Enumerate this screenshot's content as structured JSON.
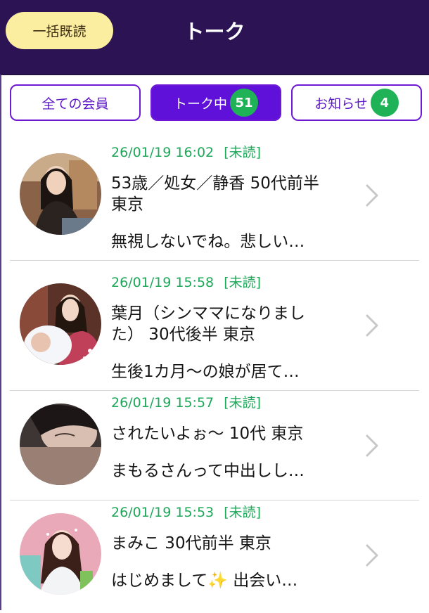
{
  "header": {
    "read_all_label": "一括既読",
    "title": "トーク"
  },
  "tabs": [
    {
      "label": "全ての会員",
      "badge": null
    },
    {
      "label": "トーク中",
      "badge": "51"
    },
    {
      "label": "お知らせ",
      "badge": "4"
    }
  ],
  "conversations": [
    {
      "timestamp": "26/01/19 16:02",
      "status": "[未読]",
      "name": "53歳／処女／静香 50代前半 東京",
      "preview": "無視しないでね。悲しい…"
    },
    {
      "timestamp": "26/01/19 15:58",
      "status": "[未読]",
      "name": "葉月（シンママになりました） 30代後半 東京",
      "preview": "生後1カ月～の娘が居て…"
    },
    {
      "timestamp": "26/01/19 15:57",
      "status": "[未読]",
      "name": "されたいよぉ～ 10代 東京",
      "preview": "まもるさんって中出しし…"
    },
    {
      "timestamp": "26/01/19 15:53",
      "status": "[未読]",
      "name": "まみこ 30代前半 東京",
      "preview_before": "はじめまして",
      "preview_emoji": "✨",
      "preview_after": " 出会い…"
    }
  ],
  "colors": {
    "header_bg": "#2c1454",
    "accent": "#5f10d9",
    "badge": "#1fb257",
    "timestamp": "#1ea85a",
    "read_all_bg": "#fbeea0"
  }
}
